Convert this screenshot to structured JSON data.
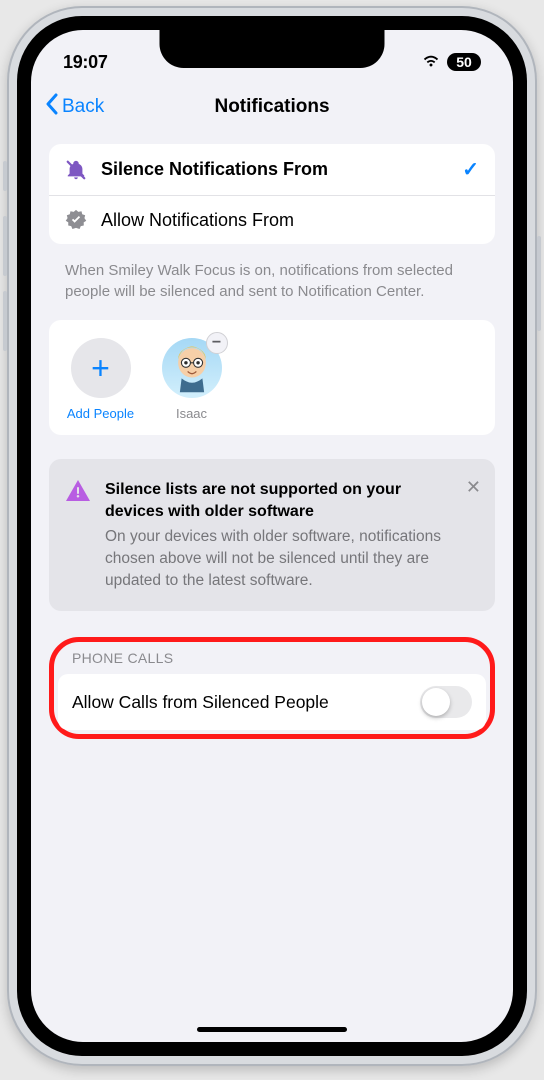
{
  "status_bar": {
    "time": "19:07",
    "battery": "50"
  },
  "nav": {
    "back_label": "Back",
    "title": "Notifications"
  },
  "options": {
    "silence_label": "Silence Notifications From",
    "allow_label": "Allow Notifications From"
  },
  "help_text": "When Smiley Walk Focus is on, notifications from selected people will be silenced and sent to Notification Center.",
  "people": {
    "add_label": "Add People",
    "contact_name": "Isaac"
  },
  "banner": {
    "title": "Silence lists are not supported on your devices with older software",
    "body": "On your devices with older software, notifications chosen above will not be silenced until they are updated to the latest software."
  },
  "phone_calls": {
    "header": "Phone Calls",
    "toggle_label": "Allow Calls from Silenced People",
    "toggle_state": false
  }
}
